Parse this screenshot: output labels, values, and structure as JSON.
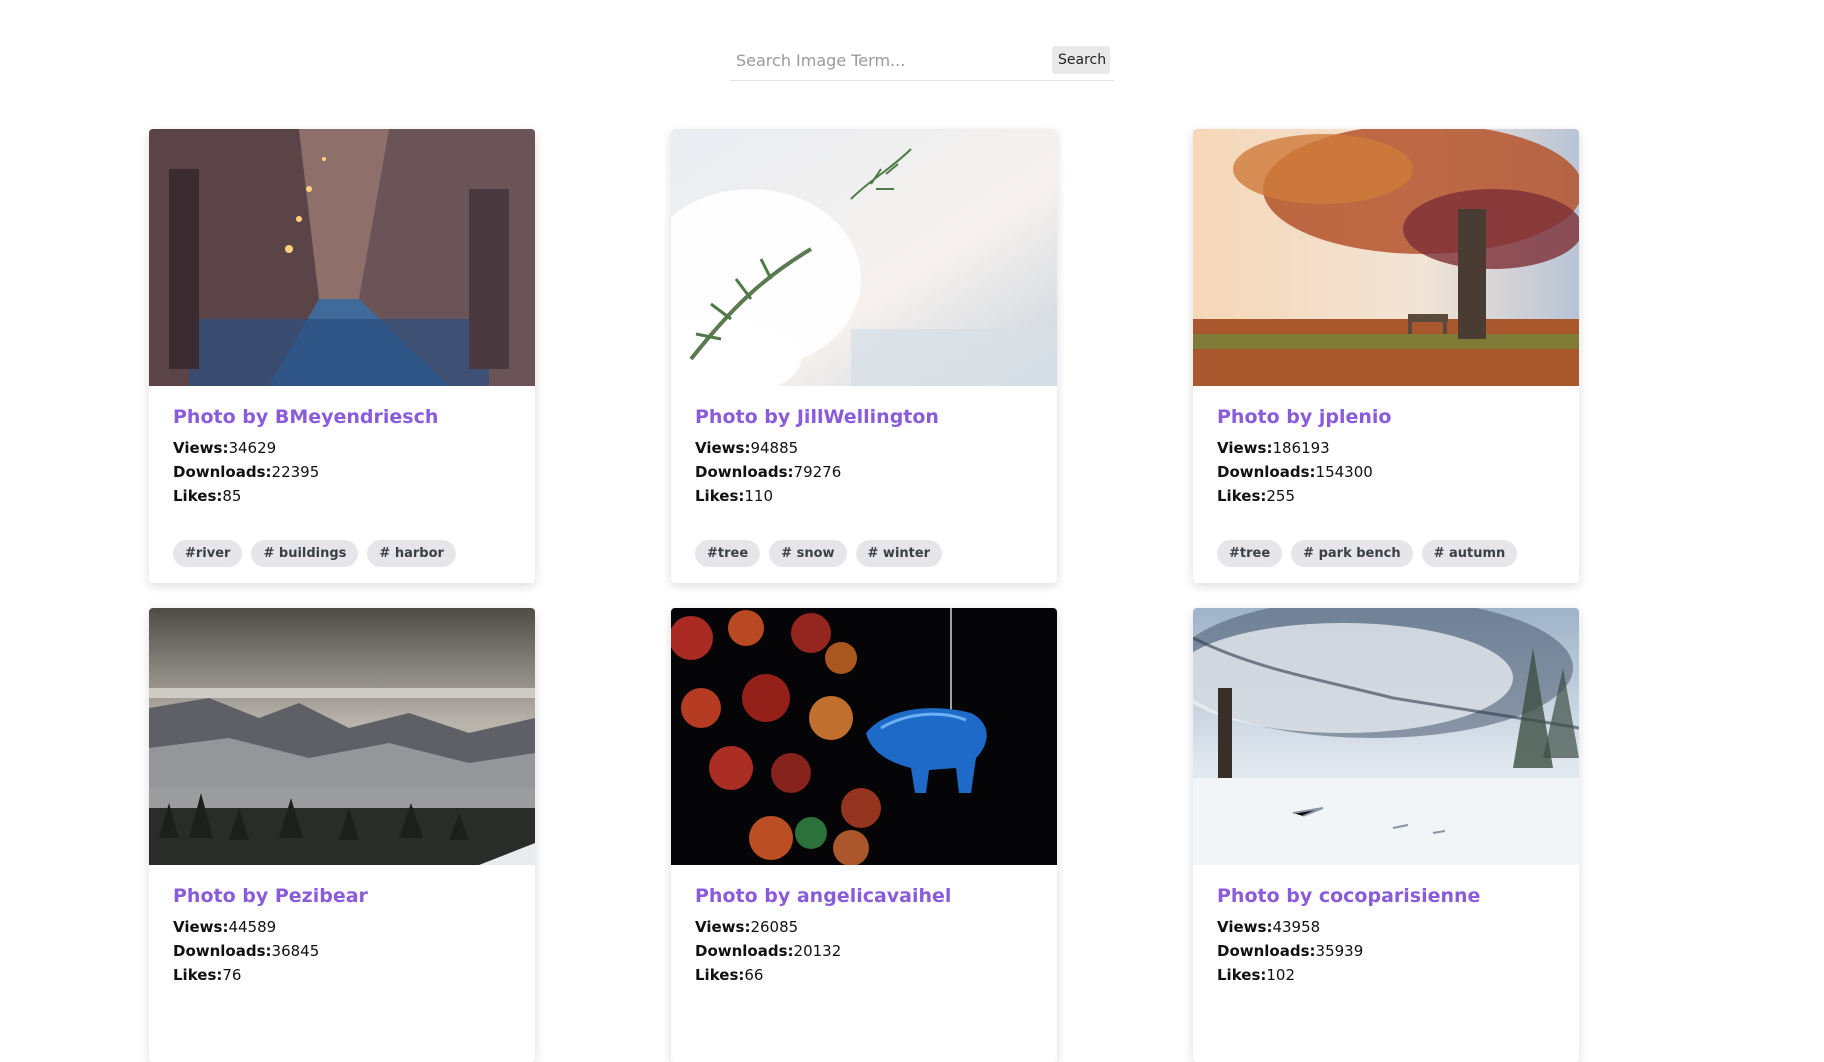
{
  "search": {
    "placeholder": "Search Image Term...",
    "button_label": "Search"
  },
  "cards": [
    {
      "title": "Photo by BMeyendriesch",
      "views_label": "Views:",
      "views": "34629",
      "downloads_label": "Downloads:",
      "downloads": "22395",
      "likes_label": "Likes:",
      "likes": "85",
      "tags": [
        "#river",
        "# buildings",
        "# harbor"
      ]
    },
    {
      "title": "Photo by JillWellington",
      "views_label": "Views:",
      "views": "94885",
      "downloads_label": "Downloads:",
      "downloads": "79276",
      "likes_label": "Likes:",
      "likes": "110",
      "tags": [
        "#tree",
        "# snow",
        "# winter"
      ]
    },
    {
      "title": "Photo by jplenio",
      "views_label": "Views:",
      "views": "186193",
      "downloads_label": "Downloads:",
      "downloads": "154300",
      "likes_label": "Likes:",
      "likes": "255",
      "tags": [
        "#tree",
        "# park bench",
        "# autumn"
      ]
    },
    {
      "title": "Photo by Pezibear",
      "views_label": "Views:",
      "views": "44589",
      "downloads_label": "Downloads:",
      "downloads": "36845",
      "likes_label": "Likes:",
      "likes": "76",
      "tags": []
    },
    {
      "title": "Photo by angelicavaihel",
      "views_label": "Views:",
      "views": "26085",
      "downloads_label": "Downloads:",
      "downloads": "20132",
      "likes_label": "Likes:",
      "likes": "66",
      "tags": []
    },
    {
      "title": "Photo by cocoparisienne",
      "views_label": "Views:",
      "views": "43958",
      "downloads_label": "Downloads:",
      "downloads": "35939",
      "likes_label": "Likes:",
      "likes": "102",
      "tags": []
    }
  ],
  "colors": {
    "title": "#8a5cdb",
    "tag_bg": "#e6e6ea",
    "button_bg": "#e9e9e9"
  }
}
